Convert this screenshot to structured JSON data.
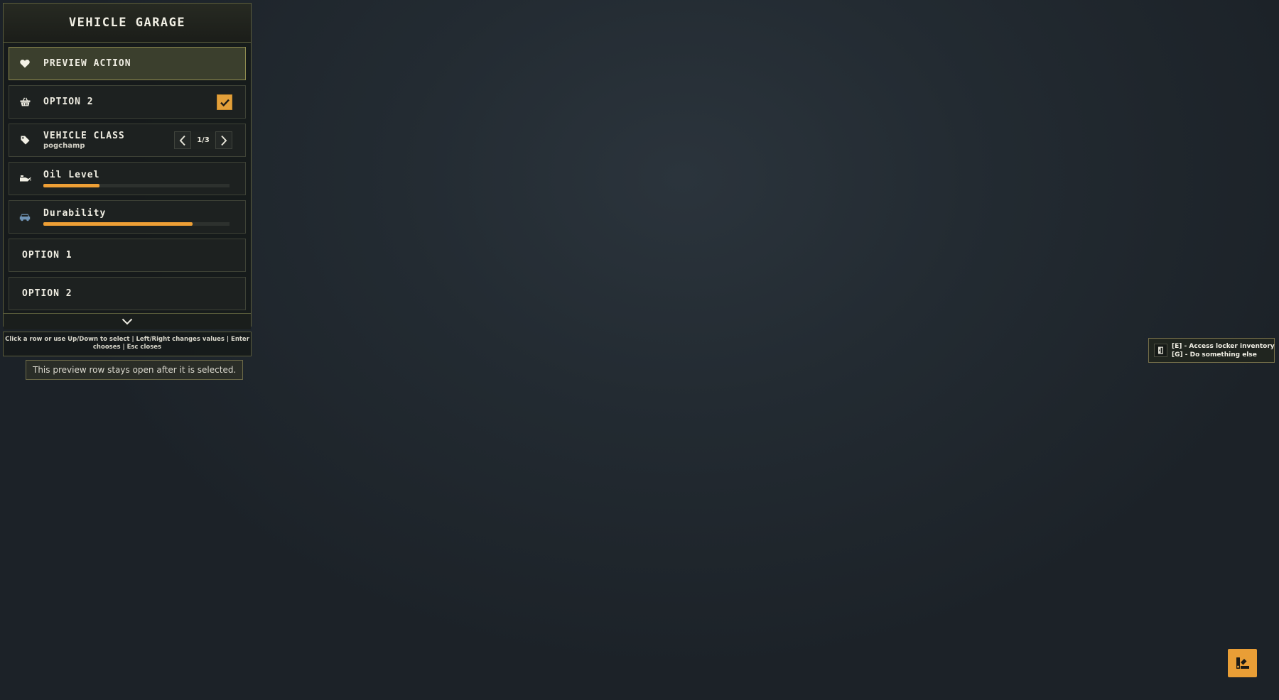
{
  "menu": {
    "title": "VEHICLE GARAGE",
    "rows": [
      {
        "type": "button",
        "icon": "heart-icon",
        "label": "PREVIEW ACTION",
        "selected": true
      },
      {
        "type": "checkbox",
        "icon": "basket-icon",
        "label": "OPTION 2",
        "checked": true
      },
      {
        "type": "list",
        "icon": "tag-icon",
        "label": "VEHICLE CLASS",
        "sub": "pogchamp",
        "value": "1/3"
      },
      {
        "type": "progress",
        "icon": "oil-can-icon",
        "label": "Oil Level",
        "progress": 0.3
      },
      {
        "type": "progress",
        "icon": "car-icon",
        "label": "Durability",
        "progress": 0.8
      },
      {
        "type": "plain",
        "label": "OPTION 1"
      },
      {
        "type": "plain",
        "label": "OPTION 2"
      }
    ]
  },
  "help": {
    "text": "Click a row or use Up/Down to select | Left/Right changes values | Enter chooses | Esc closes"
  },
  "tooltip": {
    "text": "This preview row stays open after it is selected."
  },
  "prompt": {
    "icon": "locker-icon",
    "lines": [
      "[E] - Access locker inventory",
      "[G] - Do something else"
    ]
  },
  "corner_button": {
    "icon": "paint-icon"
  },
  "colors": {
    "accent": "#ee9f35",
    "panel_border": "#5b5d3c",
    "selected_bg": "#3b3f2d",
    "car_icon": "#6f93b5"
  }
}
